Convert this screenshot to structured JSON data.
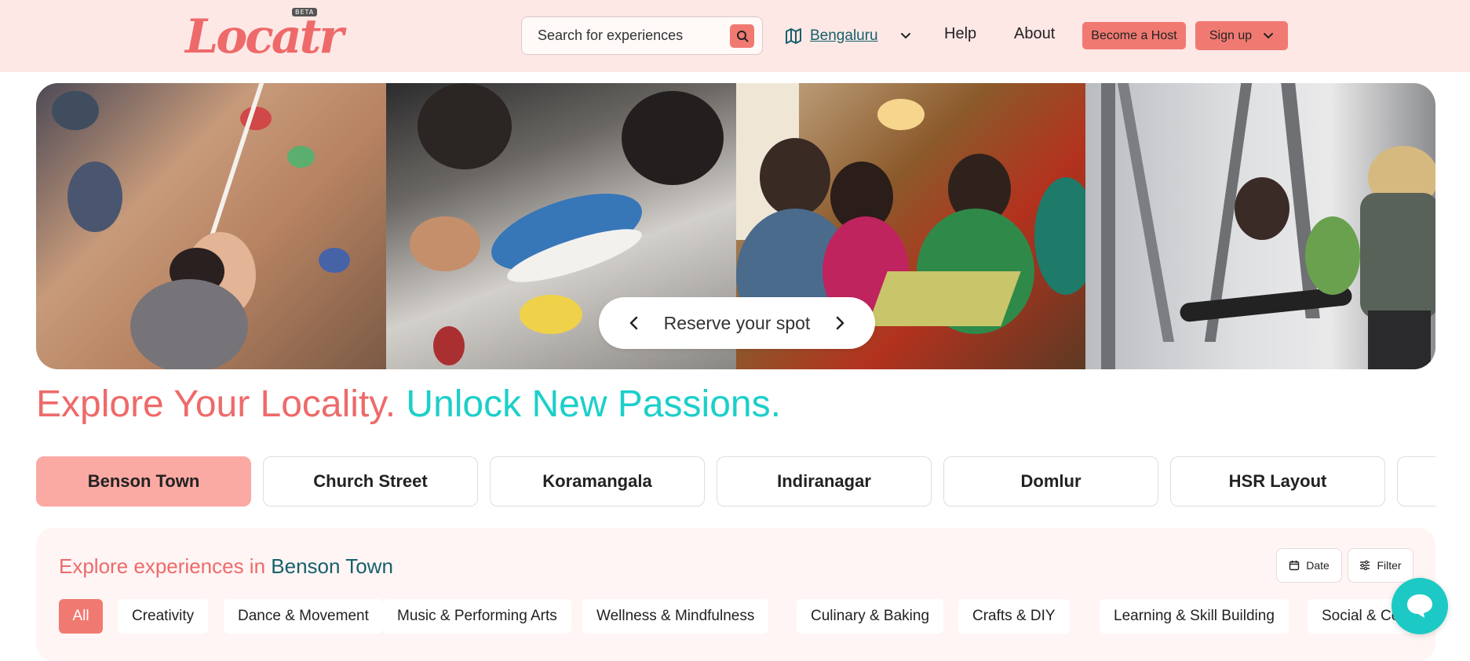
{
  "header": {
    "logo_text": "Locatr",
    "beta_label": "BETA",
    "search_placeholder": "Search for experiences",
    "city": "Bengaluru",
    "nav": {
      "help": "Help",
      "about": "About"
    },
    "become_host": "Become a Host",
    "sign_up": "Sign up"
  },
  "hero": {
    "reserve_label": "Reserve your spot"
  },
  "headline": {
    "part1": "Explore Your Locality.",
    "part2": "Unlock New Passions."
  },
  "localities": [
    "Benson Town",
    "Church Street",
    "Koramangala",
    "Indiranagar",
    "Domlur",
    "HSR Layout",
    ""
  ],
  "explore": {
    "title_prefix": "Explore experiences in",
    "title_place": "Benson Town",
    "date_label": "Date",
    "filter_label": "Filter",
    "categories": [
      "All",
      "Creativity",
      "Dance & Movement",
      "Music & Performing Arts",
      "Wellness & Mindfulness",
      "Culinary & Baking",
      "Crafts & DIY",
      "Learning & Skill Building",
      "Social & Co"
    ]
  },
  "colors": {
    "brand_red": "#ee6a6a",
    "button_red": "#f07a72",
    "teal": "#1ccfca",
    "header_bg": "#fde8e6"
  },
  "icons": [
    "search-icon",
    "map-icon",
    "chevron-down-icon",
    "chevron-left-icon",
    "chevron-right-icon",
    "calendar-icon",
    "filter-icon",
    "chat-icon"
  ]
}
